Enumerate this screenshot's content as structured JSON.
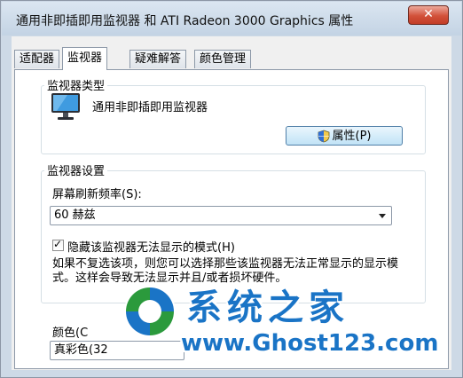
{
  "window": {
    "title": "通用非即插即用监视器 和 ATI Radeon 3000 Graphics 属性",
    "close_glyph": "✕"
  },
  "tabs": [
    {
      "label": "适配器",
      "active": false
    },
    {
      "label": "监视器",
      "active": true
    },
    {
      "label": "疑难解答",
      "active": false
    },
    {
      "label": "颜色管理",
      "active": false
    }
  ],
  "monitor_type": {
    "group_label": "监视器类型",
    "icon": "monitor-icon",
    "monitor_name": "通用非即插即用监视器",
    "properties_button": "属性(P)"
  },
  "monitor_settings": {
    "group_label": "监视器设置",
    "refresh_label": "屏幕刷新频率(S):",
    "refresh_value": "60 赫兹",
    "hide_modes_checked": true,
    "hide_modes_label": "隐藏该监视器无法显示的模式(H)",
    "description": "如果不复选该项，则您可以选择那些该监视器无法正常显示的显示模式。这样会导致无法显示并且/或者损坏硬件。"
  },
  "colors": {
    "label": "颜色(C",
    "value": "真彩色(32"
  },
  "watermark": {
    "title": "系统之家",
    "url": "www.Ghost123.com"
  },
  "colors_theme": {
    "accent": "#1a74c6",
    "tab_border": "#8d99a8",
    "titlebar": "#c3d3e4"
  }
}
